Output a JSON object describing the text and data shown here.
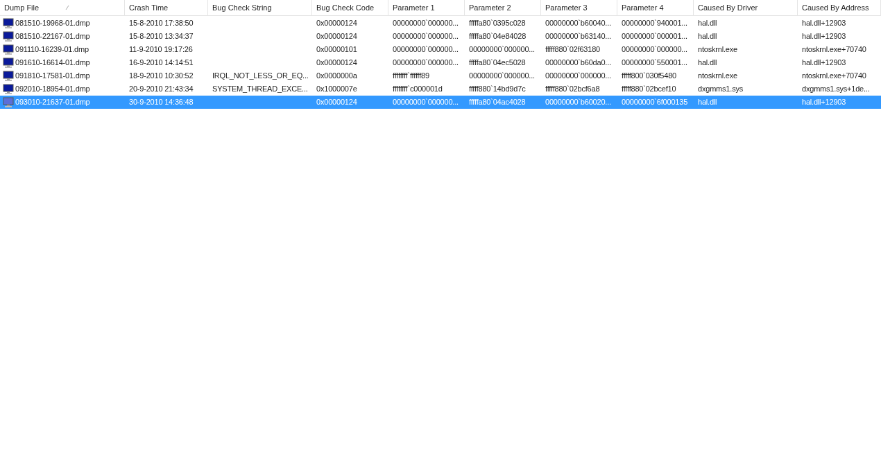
{
  "table": {
    "columns": [
      {
        "label": "Dump File",
        "sorted": true
      },
      {
        "label": "Crash Time",
        "sorted": false
      },
      {
        "label": "Bug Check String",
        "sorted": false
      },
      {
        "label": "Bug Check Code",
        "sorted": false
      },
      {
        "label": "Parameter 1",
        "sorted": false
      },
      {
        "label": "Parameter 2",
        "sorted": false
      },
      {
        "label": "Parameter 3",
        "sorted": false
      },
      {
        "label": "Parameter 4",
        "sorted": false
      },
      {
        "label": "Caused By Driver",
        "sorted": false
      },
      {
        "label": "Caused By Address",
        "sorted": false
      }
    ],
    "rows": [
      {
        "selected": false,
        "cells": [
          "081510-19968-01.dmp",
          "15-8-2010 17:38:50",
          "",
          "0x00000124",
          "00000000`000000...",
          "fffffa80`0395c028",
          "00000000`b60040...",
          "00000000`940001...",
          "hal.dll",
          "hal.dll+12903"
        ]
      },
      {
        "selected": false,
        "cells": [
          "081510-22167-01.dmp",
          "15-8-2010 13:34:37",
          "",
          "0x00000124",
          "00000000`000000...",
          "fffffa80`04e84028",
          "00000000`b63140...",
          "00000000`000001...",
          "hal.dll",
          "hal.dll+12903"
        ]
      },
      {
        "selected": false,
        "cells": [
          "091110-16239-01.dmp",
          "11-9-2010 19:17:26",
          "",
          "0x00000101",
          "00000000`000000...",
          "00000000`000000...",
          "fffff880`02f63180",
          "00000000`000000...",
          "ntoskrnl.exe",
          "ntoskrnl.exe+70740"
        ]
      },
      {
        "selected": false,
        "cells": [
          "091610-16614-01.dmp",
          "16-9-2010 14:14:51",
          "",
          "0x00000124",
          "00000000`000000...",
          "fffffa80`04ec5028",
          "00000000`b60da0...",
          "00000000`550001...",
          "hal.dll",
          "hal.dll+12903"
        ]
      },
      {
        "selected": false,
        "cells": [
          "091810-17581-01.dmp",
          "18-9-2010 10:30:52",
          "IRQL_NOT_LESS_OR_EQ...",
          "0x0000000a",
          "ffffffff`ffffff89",
          "00000000`000000...",
          "00000000`000000...",
          "fffff800`030f5480",
          "ntoskrnl.exe",
          "ntoskrnl.exe+70740"
        ]
      },
      {
        "selected": false,
        "cells": [
          "092010-18954-01.dmp",
          "20-9-2010 21:43:34",
          "SYSTEM_THREAD_EXCE...",
          "0x1000007e",
          "ffffffff`c000001d",
          "fffff880`14bd9d7c",
          "fffff880`02bcf6a8",
          "fffff880`02bcef10",
          "dxgmms1.sys",
          "dxgmms1.sys+1de..."
        ]
      },
      {
        "selected": true,
        "cells": [
          "093010-21637-01.dmp",
          "30-9-2010 14:36:48",
          "",
          "0x00000124",
          "00000000`000000...",
          "fffffa80`04ac4028",
          "00000000`b60020...",
          "00000000`6f000135",
          "hal.dll",
          "hal.dll+12903"
        ]
      }
    ]
  }
}
